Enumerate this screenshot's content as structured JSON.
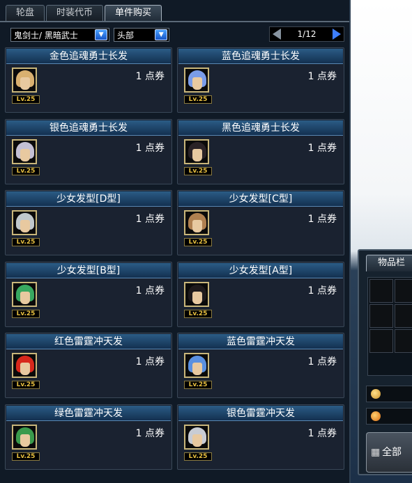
{
  "tabs": [
    {
      "label": "轮盘"
    },
    {
      "label": "时装代币"
    },
    {
      "label": "单件购买"
    }
  ],
  "filters": {
    "character": "鬼剑士/ 黑暗武士",
    "slot": "头部"
  },
  "pager": {
    "page": "1/12"
  },
  "items": [
    {
      "name": "金色追魂勇士长发",
      "price": "1 点券",
      "level": "Lv.25",
      "hair_color": "#d9b070"
    },
    {
      "name": "蓝色追魂勇士长发",
      "price": "1 点券",
      "level": "Lv.25",
      "hair_color": "#7a9ce8"
    },
    {
      "name": "银色追魂勇士长发",
      "price": "1 点券",
      "level": "Lv.25",
      "hair_color": "#c4c0d4"
    },
    {
      "name": "黑色追魂勇士长发",
      "price": "1 点券",
      "level": "Lv.25",
      "hair_color": "#2a2226"
    },
    {
      "name": "少女发型[D型]",
      "price": "1 点券",
      "level": "Lv.25",
      "hair_color": "#c0c8cc"
    },
    {
      "name": "少女发型[C型]",
      "price": "1 点券",
      "level": "Lv.25",
      "hair_color": "#b08050"
    },
    {
      "name": "少女发型[B型]",
      "price": "1 点券",
      "level": "Lv.25",
      "hair_color": "#38a860"
    },
    {
      "name": "少女发型[A型]",
      "price": "1 点券",
      "level": "Lv.25",
      "hair_color": "#1e1a1c"
    },
    {
      "name": "红色雷霆冲天发",
      "price": "1 点券",
      "level": "Lv.25",
      "hair_color": "#d8281c"
    },
    {
      "name": "蓝色雷霆冲天发",
      "price": "1 点券",
      "level": "Lv.25",
      "hair_color": "#5a90e0"
    },
    {
      "name": "绿色雷霆冲天发",
      "price": "1 点券",
      "level": "Lv.25",
      "hair_color": "#3a9a4c"
    },
    {
      "name": "银色雷霆冲天发",
      "price": "1 点券",
      "level": "Lv.25",
      "hair_color": "#c8ccd4"
    }
  ],
  "inventory": {
    "tab_label": "物品栏",
    "button_label": "全部"
  }
}
